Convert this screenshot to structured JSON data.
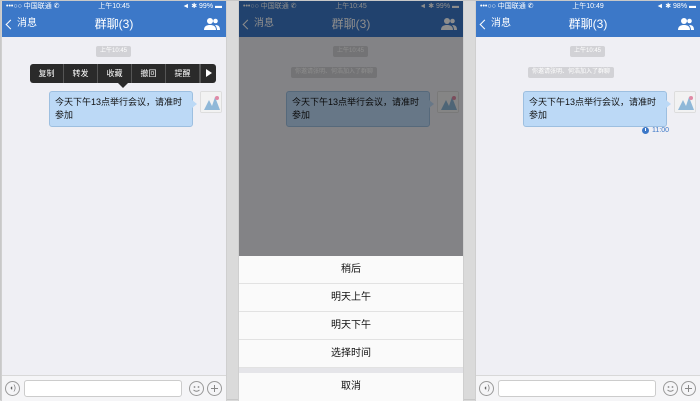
{
  "screens": [
    {
      "status": {
        "carrier": "•••○○ 中国联通 ✆",
        "time": "上午10:45",
        "right": "◄ ✱ 99% ▬"
      },
      "nav": {
        "back_label": "消息",
        "title": "群聊(3)"
      },
      "timestamp": "上午10:45",
      "context_menu": [
        "复制",
        "转发",
        "收藏",
        "撤回",
        "提醒"
      ],
      "message": "今天下午13点举行会议，请准时参加"
    },
    {
      "status": {
        "carrier": "•••○○ 中国联通 ✆",
        "time": "上午10:45",
        "right": "◄ ✱ 99% ▬"
      },
      "nav": {
        "back_label": "消息",
        "title": "群聊(3)"
      },
      "timestamp": "上午10:45",
      "system_note": "你邀请张明、何浩加入了群聊",
      "message": "今天下午13点举行会议，请准时参加",
      "sheet_options": [
        "稍后",
        "明天上午",
        "明天下午",
        "选择时间"
      ],
      "cancel_label": "取消"
    },
    {
      "status": {
        "carrier": "•••○○ 中国联通 ✆",
        "time": "上午10:49",
        "right": "◄ ✱ 98% ▬"
      },
      "nav": {
        "back_label": "消息",
        "title": "群聊(3)"
      },
      "timestamp": "上午10:45",
      "system_note": "你邀请张明、何浩加入了群聊",
      "message": "今天下午13点举行会议，请准时参加",
      "reminder_time": "11:00"
    }
  ],
  "colors": {
    "accent": "#3c78c8",
    "bubble": "#bcd9f6",
    "background": "#efeff4"
  }
}
